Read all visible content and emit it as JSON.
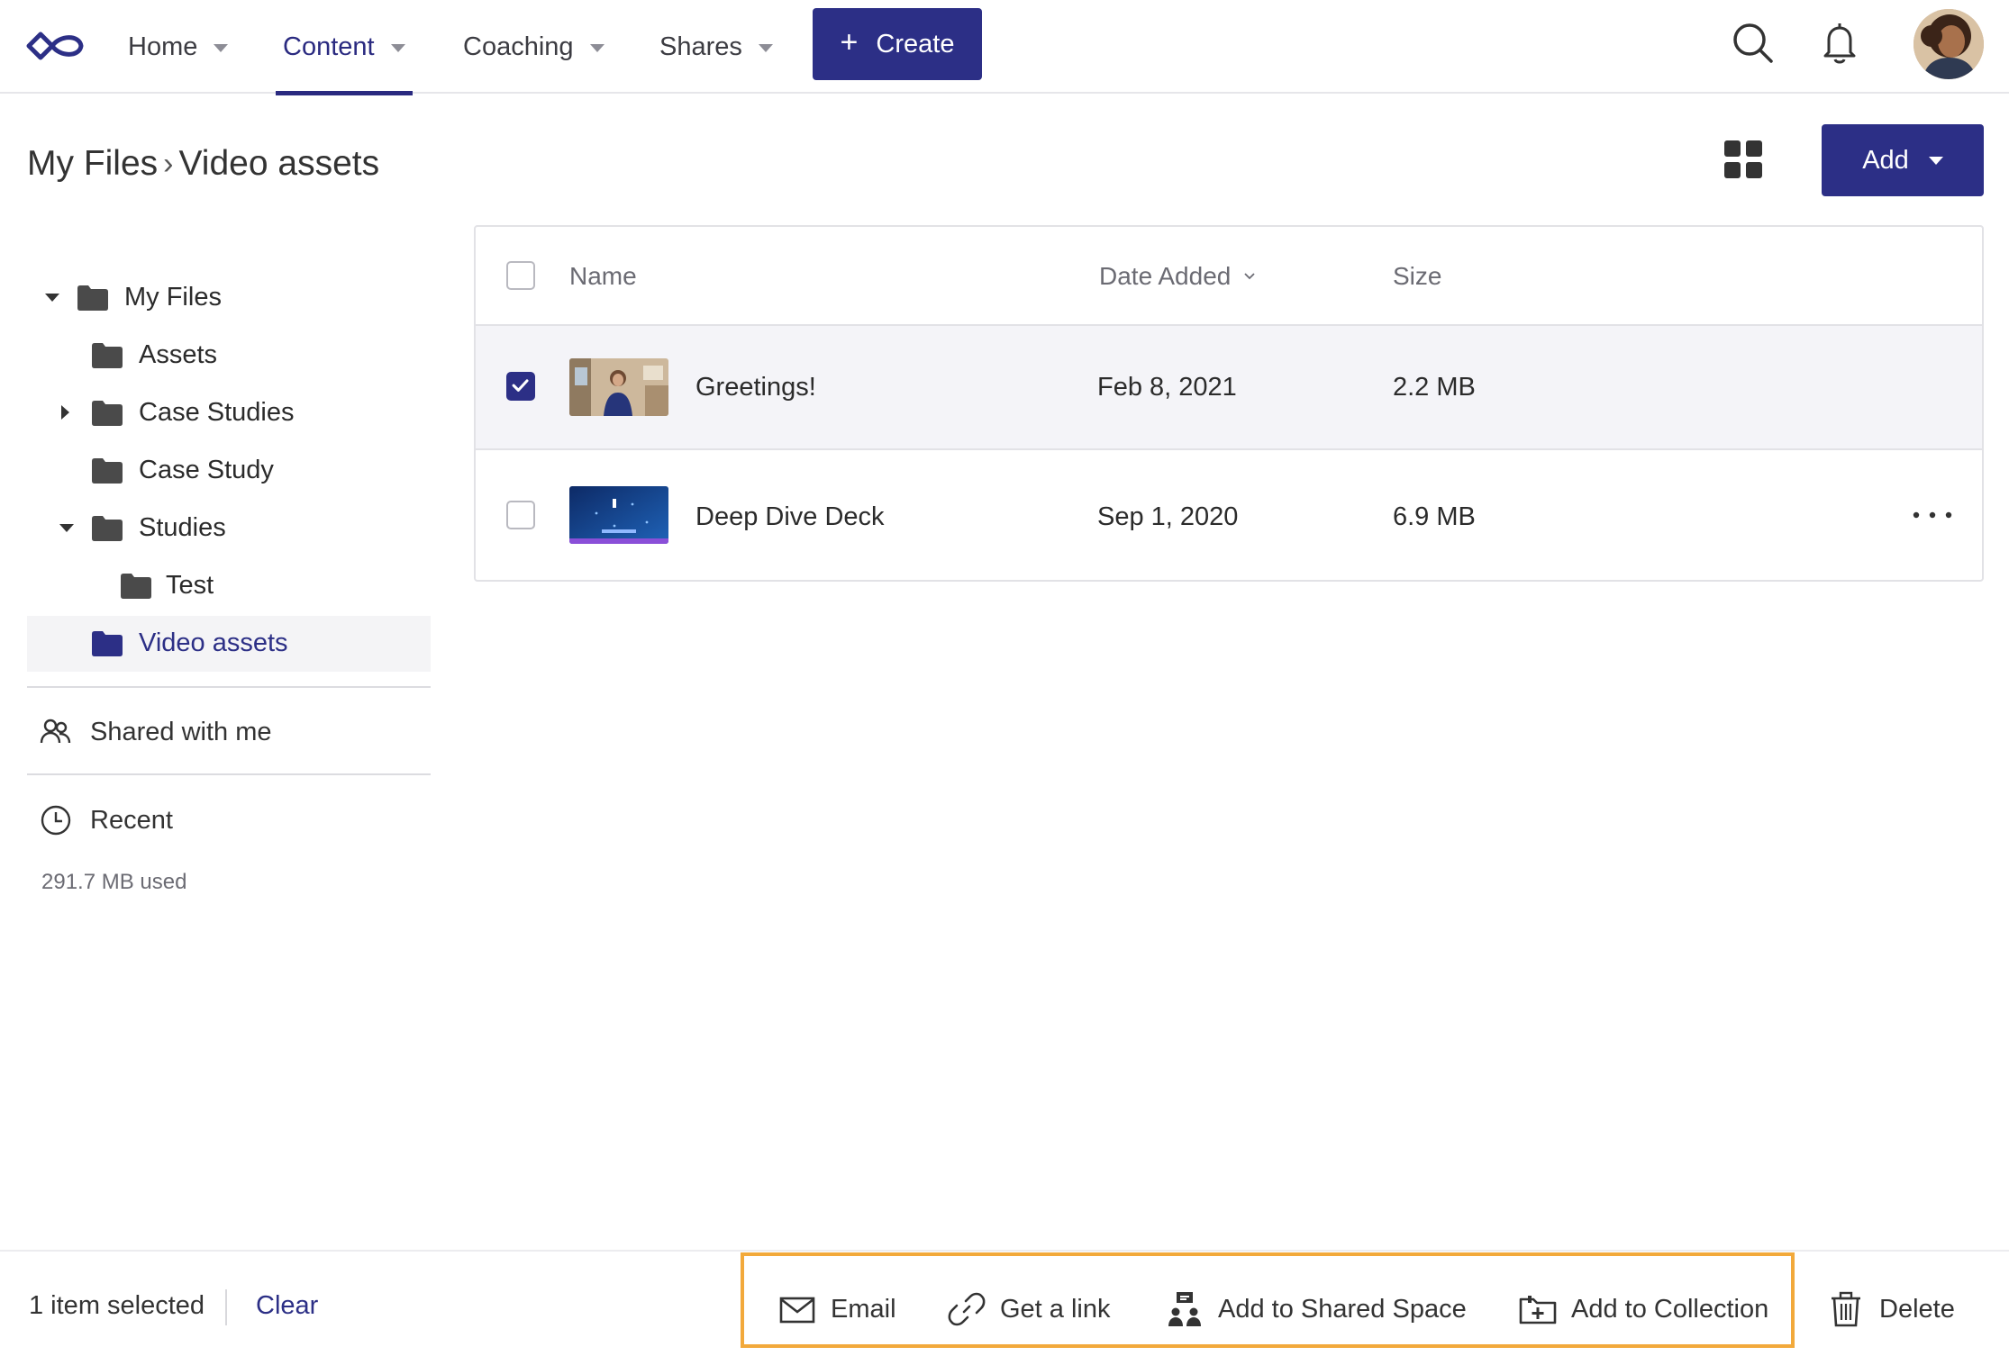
{
  "nav": {
    "items": [
      {
        "label": "Home"
      },
      {
        "label": "Content"
      },
      {
        "label": "Coaching"
      },
      {
        "label": "Shares"
      }
    ],
    "create_label": "Create",
    "active": "Content"
  },
  "header": {
    "breadcrumb": [
      "My Files",
      "Video assets"
    ],
    "add_label": "Add"
  },
  "sidebar": {
    "tree": [
      {
        "label": "My Files",
        "expand": "expanded"
      },
      {
        "label": "Assets",
        "expand": "none"
      },
      {
        "label": "Case Studies",
        "expand": "collapsed"
      },
      {
        "label": "Case Study",
        "expand": "none"
      },
      {
        "label": "Studies",
        "expand": "expanded"
      },
      {
        "label": "Test",
        "expand": "none"
      },
      {
        "label": "Video assets",
        "expand": "none",
        "selected": true
      }
    ],
    "shared_label": "Shared with me",
    "recent_label": "Recent",
    "storage": "291.7 MB used"
  },
  "table": {
    "columns": {
      "name": "Name",
      "date": "Date Added",
      "size": "Size"
    },
    "rows": [
      {
        "name": "Greetings!",
        "date": "Feb 8, 2021",
        "size": "2.2 MB",
        "selected": true
      },
      {
        "name": "Deep Dive Deck",
        "date": "Sep 1, 2020",
        "size": "6.9 MB",
        "selected": false
      }
    ]
  },
  "bottom": {
    "selected_text": "1 item selected",
    "clear_label": "Clear",
    "actions": {
      "email": "Email",
      "link": "Get a link",
      "shared_space": "Add to Shared Space",
      "collection": "Add to Collection",
      "delete": "Delete"
    }
  },
  "colors": {
    "primary": "#2c2f86",
    "highlight_border": "#f2a93b"
  }
}
